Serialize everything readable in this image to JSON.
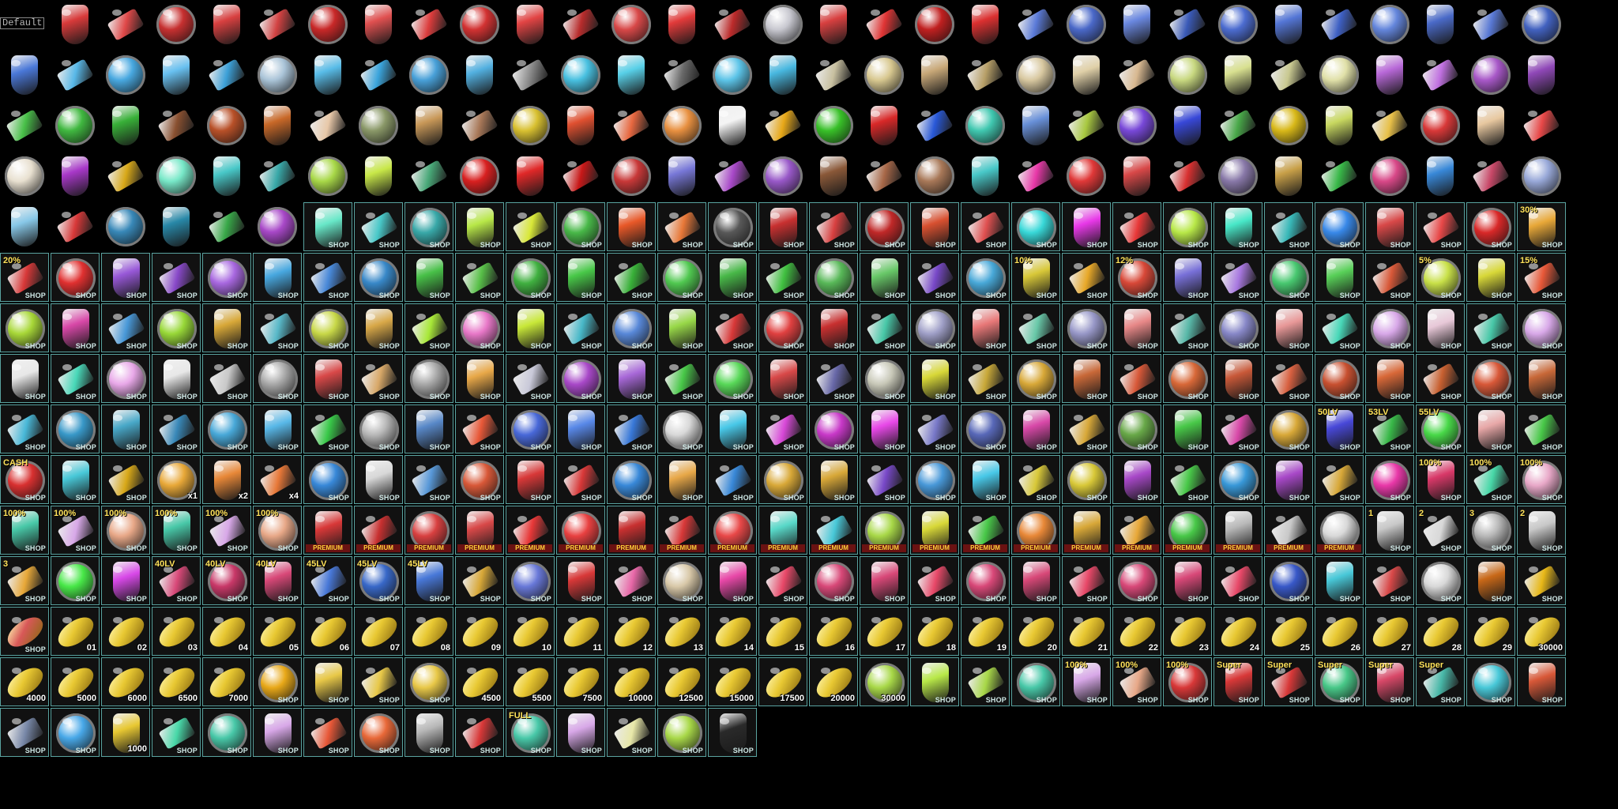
{
  "sheet": {
    "label": "Default",
    "shop_text": "SHOP",
    "premium_text": "PREMIUM"
  },
  "colors": {
    "background": "#000000",
    "frame": "#5aa3a0",
    "capsule": "#e8c832",
    "premium_band": "#6a1212",
    "premium_text": "#ffd23a"
  },
  "rows": [
    {
      "icon": "vial-icon",
      "palette": [
        "#b8c8d8",
        "#d83a3a",
        "#e04848",
        "#c63030",
        "#d84040",
        "#d24242",
        "#c82828",
        "#e05050",
        "#dc3c3c",
        "#d23232",
        "#e24444",
        "#b82c2c",
        "#d84848",
        "#e23a3a",
        "#bc2a2a",
        "#c8c8d0",
        "#d84040",
        "#e03434",
        "#c02020",
        "#dc3030",
        "#5a7ad8",
        "#4a68c8",
        "#6a88e0",
        "#3a5ab8",
        "#4c6cd0",
        "#5476d6",
        "#3e60c4",
        "#6486dc",
        "#4a6ac8",
        "#5878d4",
        "#4262c0"
      ]
    },
    {
      "icon": "flask-icon",
      "palette": [
        "#4a78d8",
        "#58b8e8",
        "#48a8e0",
        "#68c0f0",
        "#3ca0d8",
        "#aac4d8",
        "#58bce8",
        "#3aa4dc",
        "#48a0d8",
        "#52b0e0",
        "#8a8a8a",
        "#48c0e0",
        "#58d0e8",
        "#6a6a6a",
        "#5cc4e8",
        "#48b8e0",
        "#c8c0a0",
        "#d8c890",
        "#c8a878",
        "#b8a068",
        "#d8c8a0",
        "#e0d0a8",
        "#d8b890",
        "#c8d880",
        "#d8e090",
        "#c8c890",
        "#e0e0a8",
        "#b868d8",
        "#c070e0",
        "#a858c8",
        "#9048b8"
      ]
    },
    {
      "icon": "orb-icon",
      "palette": [
        "#48c048",
        "#40b840",
        "#38b038",
        "#8a5030",
        "#b85028",
        "#c86828",
        "#e8c8a8",
        "#8a9868",
        "#c89858",
        "#a87858",
        "#d8c030",
        "#e05030",
        "#e86840",
        "#e89040",
        "#f4f4f4",
        "#e8a818",
        "#38c028",
        "#d82828",
        "#2858d8",
        "#40c8b0",
        "#6890d8",
        "#a8c840",
        "#7848d8",
        "#3848d8",
        "#48a848",
        "#d8b818",
        "#c8d860",
        "#e8c048",
        "#d83838",
        "#e8c8a0",
        "#e84848"
      ]
    },
    {
      "icon": "gift-box-icon",
      "palette": [
        "#e8e0d0",
        "#a838c8",
        "#d8a818",
        "#78e8c8",
        "#48c8c8",
        "#38a8a8",
        "#a8d848",
        "#c8e848",
        "#48a878",
        "#d82020",
        "#e02828",
        "#c81818",
        "#c83838",
        "#7878d8",
        "#a848c8",
        "#9858c8",
        "#8a5838",
        "#a86848",
        "#a87858",
        "#48c8c8",
        "#e838a8",
        "#e03838",
        "#d84848",
        "#d83030",
        "#8878a8",
        "#c8a048",
        "#38b848",
        "#d84888",
        "#3888d8",
        "#c84868",
        "#98a8d8"
      ]
    },
    {
      "icon": "potion-icon",
      "palette": [
        "#88c8e8",
        "#d83838",
        "#3888b8",
        "#2888a8",
        "#38a848",
        "#a848c8",
        "#68e8c8",
        "#48c8c8",
        "#38a8a8",
        "#b8e848",
        "#d8e838",
        "#48b848",
        "#e85828",
        "#e87838",
        "#585858",
        "#c83030",
        "#d84040",
        "#c02828",
        "#d85030",
        "#e05050",
        "#38d8d8",
        "#e838e8",
        "#e83838",
        "#b8e848",
        "#48e8c8",
        "#38b8b8",
        "#3888e8",
        "#d84848",
        "#e84848",
        "#d82828",
        "#e8a838"
      ]
    },
    {
      "icon": "bottle-icon",
      "palette": [
        "#d83838",
        "#e03030",
        "#9858d8",
        "#8848c8",
        "#a868e0",
        "#48a8e0",
        "#4888d8",
        "#3888c8",
        "#48c048",
        "#58c048",
        "#40b040",
        "#48c848",
        "#38b038",
        "#50c850",
        "#48b848",
        "#40c040",
        "#58b858",
        "#68c868",
        "#7848c8",
        "#48a8d8",
        "#d8c838",
        "#e8a828",
        "#d84838",
        "#7870d8",
        "#a878e0",
        "#48c870",
        "#58d058",
        "#d85838",
        "#c8e048",
        "#d8d838",
        "#e85838"
      ]
    },
    {
      "icon": "tube-icon",
      "palette": [
        "#a8d838",
        "#d848a8",
        "#4898d8",
        "#98d838",
        "#d8a838",
        "#58b8c8",
        "#c8d848",
        "#d8a848",
        "#a8e838",
        "#e878c8",
        "#c8e838",
        "#48b8c8",
        "#5888d8",
        "#98d848",
        "#d83838",
        "#e04040",
        "#c83030",
        "#48c8a8",
        "#a0a0c8",
        "#e87878",
        "#68c8a8",
        "#9898c8",
        "#e88888",
        "#58b8a8",
        "#8888c8",
        "#e89898",
        "#48d8b8",
        "#d8a8e8",
        "#e8c8d8",
        "#48c8a8",
        "#d8a8e8"
      ]
    },
    {
      "icon": "crate-icon",
      "palette": [
        "#e8e8e8",
        "#48d8b8",
        "#e8a8e8",
        "#e8e8e8",
        "#c8c8c8",
        "#a8a8a8",
        "#d84848",
        "#d8a868",
        "#a8a8a8",
        "#e8a848",
        "#c8c8d8",
        "#a848c8",
        "#a868d8",
        "#48c848",
        "#58d858",
        "#d84848",
        "#6868a8",
        "#c8c8b8",
        "#d8d838",
        "#c8a838",
        "#d8a838",
        "#c86838",
        "#d85838",
        "#d86838",
        "#c85838",
        "#d86040",
        "#c85030",
        "#d86838",
        "#c86030",
        "#d85838",
        "#c86838"
      ]
    },
    {
      "icon": "emblem-icon",
      "palette": [
        "#48b8d8",
        "#3898c8",
        "#48a8c8",
        "#3888b8",
        "#48a8d8",
        "#58b8e8",
        "#38c848",
        "#b8b8b8",
        "#5888c8",
        "#e85838",
        "#4868d8",
        "#5888e8",
        "#3878d8",
        "#d8d8d8",
        "#48c8e8",
        "#d848d8",
        "#c838c8",
        "#e848e8",
        "#7878c8",
        "#5868b8",
        "#d848a8",
        "#d8a838",
        "#68a848",
        "#48c848",
        "#d848a8",
        "#d8a838",
        "#4848d8",
        "#38b848",
        "#48d848",
        "#e8a8a8",
        "#48c848"
      ]
    },
    {
      "icon": "card-icon",
      "palette": [
        "#d83030",
        "#48c8d8",
        "#d8a818",
        "#e8a838",
        "#e88838",
        "#e87838",
        "#3888d8",
        "#d8d8d8",
        "#5898d8",
        "#d85838",
        "#d83838",
        "#d83838",
        "#3888d8",
        "#e8a848",
        "#3888d8",
        "#d8a838",
        "#d8a838",
        "#7848c8",
        "#4898d8",
        "#48c8e8",
        "#d8c838",
        "#d8c838",
        "#a848c8",
        "#48c848",
        "#3898d8",
        "#a848c8",
        "#d8a838",
        "#e838a8",
        "#d83868",
        "#48d8a8",
        "#e8a8c8"
      ]
    },
    {
      "icon": "jar-icon",
      "palette": [
        "#48c8a8",
        "#d8a8e8",
        "#e8a888",
        "#48c8a8",
        "#d8a8e8",
        "#e8a888",
        "#d83838",
        "#c83030",
        "#d84040",
        "#d84848",
        "#e83838",
        "#e84040",
        "#c83030",
        "#d83838",
        "#e84848",
        "#58d8c8",
        "#48c8d8",
        "#a8d848",
        "#d8d838",
        "#48c848",
        "#e88838",
        "#d8a838",
        "#e8a838",
        "#48c848",
        "#b8b8b8",
        "#c8c8c8",
        "#d8d8d8",
        "#c8c8c8",
        "#d8d8d8",
        "#b8b8b8",
        "#c8c8c8"
      ]
    },
    {
      "icon": "level-box-icon",
      "palette": [
        "#e8a838",
        "#48e848",
        "#d848e8",
        "#d84878",
        "#c83868",
        "#d84878",
        "#4878d8",
        "#3868c8",
        "#4878d8",
        "#d8a838",
        "#6878d8",
        "#d83838",
        "#e868a8",
        "#d8c8a8",
        "#e848a8",
        "#e84868",
        "#d84878",
        "#d84878",
        "#e84868",
        "#d84878",
        "#d84878",
        "#e84868",
        "#d84878",
        "#d84878",
        "#e84868",
        "#3858c8",
        "#48c8d8",
        "#d84848",
        "#d8d8d8",
        "#c86818",
        "#e8b818"
      ]
    },
    {
      "icon": "capsule-icon",
      "palette": [
        "#d85858",
        "#e8c832",
        "#e8c832",
        "#e8c832",
        "#e8c832",
        "#e8c832",
        "#e8c832",
        "#e8c832",
        "#e8c832",
        "#e8c832",
        "#e8c832",
        "#e8c832",
        "#e8c832",
        "#e8c832",
        "#e8c832",
        "#e8c832",
        "#e8c832",
        "#e8c832",
        "#e8c832",
        "#e8c832",
        "#e8c832",
        "#e8c832",
        "#e8c832",
        "#e8c832",
        "#e8c832",
        "#e8c832",
        "#e8c832",
        "#e8c832",
        "#e8c832",
        "#e8c832",
        "#e8c832"
      ]
    },
    {
      "icon": "chest-icon",
      "palette": [
        "#e8c832",
        "#e8c832",
        "#e8c832",
        "#e8c832",
        "#e8c832",
        "#e8a818",
        "#e8c848",
        "#e8c848",
        "#e8c848",
        "#e8c832",
        "#e8c832",
        "#e8c832",
        "#e8c832",
        "#e8c832",
        "#e8c832",
        "#e8c832",
        "#e8c832",
        "#a8d848",
        "#b8e848",
        "#a8d848",
        "#48c8a8",
        "#d8a8e8",
        "#e8a888",
        "#d83838",
        "#d83838",
        "#d83838",
        "#48c888",
        "#d84868",
        "#48b8a8",
        "#48c8d8",
        "#d85838"
      ]
    },
    {
      "icon": "card-icon",
      "palette": [
        "#7888a8",
        "#48a8e8",
        "#e8c832",
        "#48d8a8",
        "#48c8a8",
        "#d8a8e8",
        "#e85838",
        "#e86838",
        "#b8b8b8",
        "#d83838",
        "#48c8a8",
        "#d8a8e8",
        "#e8e8a8",
        "#a8d848",
        "#2a2a2a",
        "#2a2a2a",
        "#2a2a2a",
        "#2a2a2a",
        "#2a2a2a",
        "#2a2a2a",
        "#2a2a2a",
        "#2a2a2a",
        "#2a2a2a",
        "#2a2a2a",
        "#2a2a2a",
        "#2a2a2a",
        "#2a2a2a",
        "#2a2a2a",
        "#2a2a2a",
        "#2a2a2a",
        "#2a2a2a"
      ]
    }
  ],
  "cells": {
    "r0": [
      {
        "frame": false
      },
      {
        "frame": false
      },
      {
        "frame": false
      },
      {
        "frame": false
      },
      {
        "frame": false
      },
      {
        "frame": false
      },
      {
        "frame": false
      },
      {
        "frame": false
      },
      {
        "frame": false
      },
      {
        "frame": false
      },
      {
        "frame": false
      },
      {
        "frame": false
      },
      {
        "frame": false
      },
      {
        "frame": false
      },
      {
        "frame": false
      },
      {
        "frame": false
      },
      {
        "frame": false
      },
      {
        "frame": false
      },
      {
        "frame": false
      },
      {
        "frame": false
      },
      {
        "frame": false
      },
      {
        "frame": false
      },
      {
        "frame": false
      },
      {
        "frame": false
      },
      {
        "frame": false
      },
      {
        "frame": false
      },
      {
        "frame": false
      },
      {
        "frame": false
      },
      {
        "frame": false
      },
      {
        "frame": false
      },
      {
        "frame": false
      }
    ]
  },
  "row_specs": [
    {
      "count": 31,
      "framed_from": 99,
      "shop": false,
      "badges": {},
      "amounts": {},
      "premium": []
    },
    {
      "count": 31,
      "framed_from": 99,
      "shop": false,
      "badges": {},
      "amounts": {},
      "premium": []
    },
    {
      "count": 31,
      "framed_from": 99,
      "shop": false,
      "badges": {},
      "amounts": {},
      "premium": []
    },
    {
      "count": 31,
      "framed_from": 99,
      "shop": false,
      "badges": {},
      "amounts": {},
      "premium": []
    },
    {
      "count": 31,
      "framed_from": 6,
      "shop": true,
      "badges": {
        "30": "30%"
      },
      "amounts": {},
      "premium": []
    },
    {
      "count": 31,
      "framed_from": 0,
      "shop": true,
      "badges": {
        "0": "20%",
        "20": "10%",
        "22": "12%",
        "28": "5%",
        "30": "15%"
      },
      "amounts": {},
      "premium": []
    },
    {
      "count": 31,
      "framed_from": 0,
      "shop": true,
      "badges": {},
      "amounts": {},
      "premium": []
    },
    {
      "count": 31,
      "framed_from": 0,
      "shop": true,
      "badges": {},
      "amounts": {},
      "premium": []
    },
    {
      "count": 31,
      "framed_from": 0,
      "shop": true,
      "badges": {
        "26": "50LV",
        "27": "53LV",
        "28": "55LV"
      },
      "amounts": {},
      "premium": []
    },
    {
      "count": 31,
      "framed_from": 0,
      "shop": true,
      "badges": {
        "0": "CASH",
        "28": "100%",
        "29": "100%",
        "30": "100%"
      },
      "amounts": {
        "3": "x1",
        "4": "x2",
        "5": "x4"
      },
      "premium": []
    },
    {
      "count": 31,
      "framed_from": 0,
      "shop": true,
      "badges": {
        "0": "100%",
        "1": "100%",
        "2": "100%",
        "3": "100%",
        "4": "100%",
        "5": "100%",
        "27": "1",
        "28": "2",
        "29": "3",
        "30": "2"
      },
      "amounts": {},
      "premium": [
        6,
        7,
        8,
        9,
        10,
        11,
        12,
        13,
        14,
        15,
        16,
        17,
        18,
        19,
        20,
        21,
        22,
        23,
        24,
        25,
        26
      ]
    },
    {
      "count": 31,
      "framed_from": 0,
      "shop": true,
      "badges": {
        "0": "3",
        "3": "40LV",
        "4": "40LV",
        "5": "40LV",
        "6": "45LV",
        "7": "45LV",
        "8": "45LV"
      },
      "amounts": {},
      "premium": []
    },
    {
      "count": 31,
      "framed_from": 0,
      "shop": true,
      "badges": {},
      "amounts": {
        "1": "01",
        "2": "02",
        "3": "03",
        "4": "04",
        "5": "05",
        "6": "06",
        "7": "07",
        "8": "08",
        "9": "09",
        "10": "10",
        "11": "11",
        "12": "12",
        "13": "13",
        "14": "14",
        "15": "15",
        "16": "16",
        "17": "17",
        "18": "18",
        "19": "19",
        "20": "20",
        "21": "21",
        "22": "22",
        "23": "23",
        "24": "24",
        "25": "25",
        "26": "26",
        "27": "27",
        "28": "28",
        "29": "29",
        "30": "30000"
      },
      "premium": []
    },
    {
      "count": 31,
      "framed_from": 0,
      "shop": true,
      "badges": {
        "21": "100%",
        "22": "100%",
        "23": "100%",
        "24": "Super",
        "25": "Super",
        "26": "Super",
        "27": "Super",
        "28": "Super"
      },
      "amounts": {
        "0": "4000",
        "1": "5000",
        "2": "6000",
        "3": "6500",
        "4": "7000",
        "9": "4500",
        "10": "5500",
        "11": "7500",
        "12": "10000",
        "13": "12500",
        "14": "15000",
        "15": "17500",
        "16": "20000",
        "17": "30000"
      },
      "premium": []
    },
    {
      "count": 15,
      "framed_from": 0,
      "shop": true,
      "badges": {
        "10": "FULL"
      },
      "amounts": {
        "2": "1000"
      },
      "premium": []
    }
  ]
}
